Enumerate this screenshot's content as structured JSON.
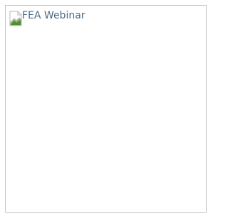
{
  "image": {
    "alt_text": "FEA Webinar",
    "icon": "broken-image-icon"
  }
}
